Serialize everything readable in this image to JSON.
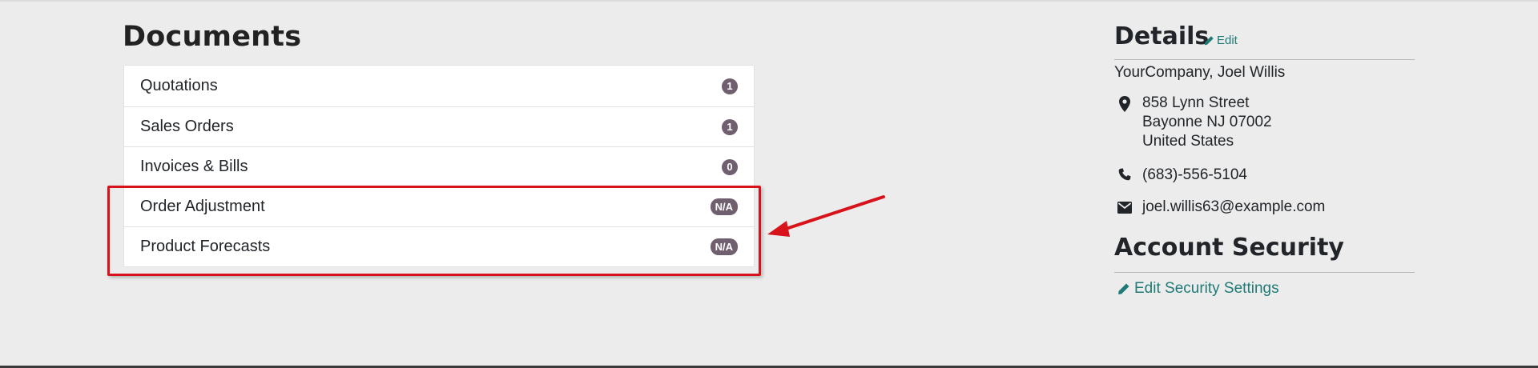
{
  "documents": {
    "title": "Documents",
    "items": [
      {
        "label": "Quotations",
        "count": "1"
      },
      {
        "label": "Sales Orders",
        "count": "1"
      },
      {
        "label": "Invoices & Bills",
        "count": "0"
      },
      {
        "label": "Order Adjustment",
        "count": "N/A"
      },
      {
        "label": "Product Forecasts",
        "count": "N/A"
      }
    ]
  },
  "details": {
    "title": "Details",
    "edit_label": "Edit",
    "company": "YourCompany, Joel Willis",
    "address_line1": "858 Lynn Street",
    "address_line2": "Bayonne NJ 07002",
    "address_line3": "United States",
    "phone": "(683)-556-5104",
    "email": "joel.willis63@example.com"
  },
  "security": {
    "title": "Account Security",
    "link_label": "Edit Security Settings"
  },
  "colors": {
    "link": "#1f7a75",
    "badge": "#6f5f6f",
    "annotation": "#d8121b"
  },
  "icons": {
    "edit": "pencil-icon",
    "address": "map-marker-icon",
    "phone": "phone-icon",
    "email": "envelope-icon"
  }
}
